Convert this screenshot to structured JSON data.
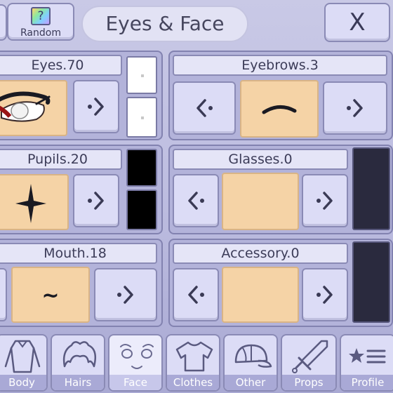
{
  "header": {
    "title": "Eyes & Face",
    "random_label": "Random",
    "random_glyph": "?",
    "close_label": "X"
  },
  "panels": {
    "eyes": {
      "label": "Eyes.70"
    },
    "eyebrows": {
      "label": "Eyebrows.3"
    },
    "pupils": {
      "label": "Pupils.20"
    },
    "glasses": {
      "label": "Glasses.0"
    },
    "mouth": {
      "label": "Mouth.18",
      "glyph": "~"
    },
    "accessory": {
      "label": "Accessory.0"
    }
  },
  "tabs": [
    {
      "label": "Body",
      "icon": "body-icon"
    },
    {
      "label": "Hairs",
      "icon": "hair-icon"
    },
    {
      "label": "Face",
      "icon": "face-icon",
      "active": true
    },
    {
      "label": "Clothes",
      "icon": "shirt-icon"
    },
    {
      "label": "Other",
      "icon": "cap-icon"
    },
    {
      "label": "Props",
      "icon": "sword-icon"
    },
    {
      "label": "Profile",
      "icon": "star-list-icon"
    }
  ],
  "colors": {
    "preview_bg": "#f5d3a6",
    "panel_bg": "#b3b3da",
    "button_bg": "#dcdcf6",
    "eye_swatch_1": "#ffffff",
    "eye_swatch_2": "#ffffff",
    "pupil_swatch_1": "#000000",
    "pupil_swatch_2": "#000000",
    "glasses_swatch": "#2a2a3e",
    "accessory_swatch": "#2a2a3e"
  }
}
